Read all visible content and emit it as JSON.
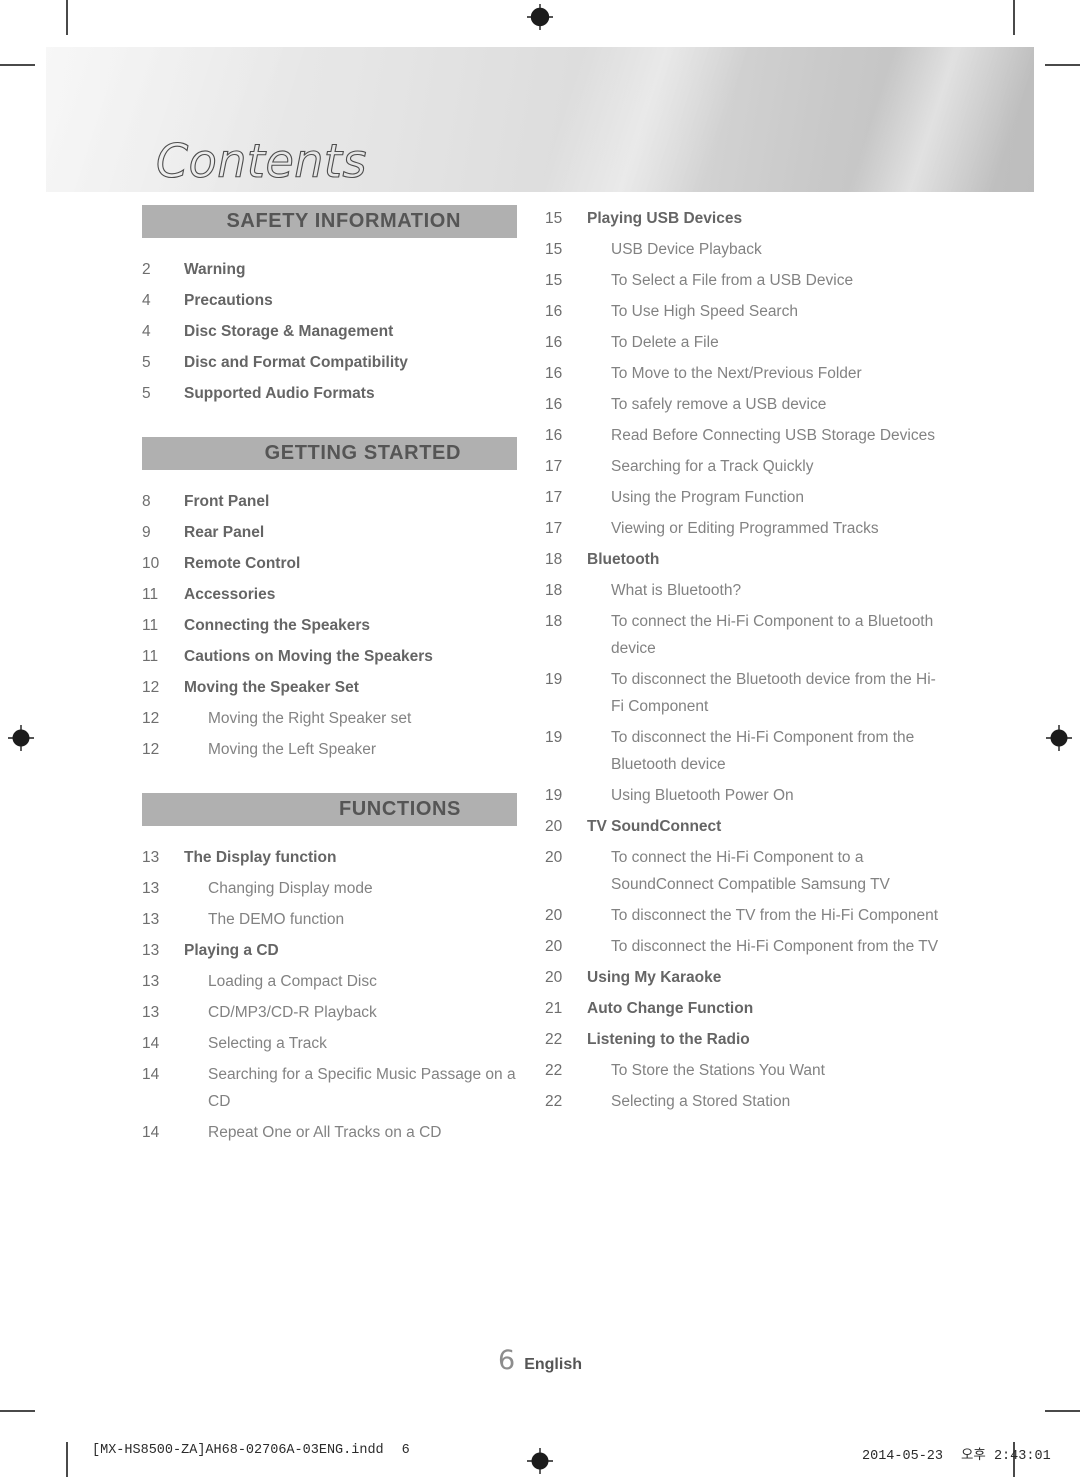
{
  "banner": {
    "title": "Contents"
  },
  "columns": {
    "left": [
      {
        "type": "section",
        "label": "SAFETY INFORMATION",
        "entries": [
          {
            "page": "2",
            "title": "Warning",
            "level": 1
          },
          {
            "page": "4",
            "title": "Precautions",
            "level": 1
          },
          {
            "page": "4",
            "title": "Disc Storage & Management",
            "level": 1
          },
          {
            "page": "5",
            "title": "Disc and Format Compatibility",
            "level": 1
          },
          {
            "page": "5",
            "title": "Supported Audio Formats",
            "level": 1
          }
        ]
      },
      {
        "type": "section",
        "label": "GETTING STARTED",
        "entries": [
          {
            "page": "8",
            "title": "Front Panel",
            "level": 1
          },
          {
            "page": "9",
            "title": "Rear Panel",
            "level": 1
          },
          {
            "page": "10",
            "title": "Remote Control",
            "level": 1
          },
          {
            "page": "11",
            "title": "Accessories",
            "level": 1
          },
          {
            "page": "11",
            "title": "Connecting the Speakers",
            "level": 1
          },
          {
            "page": "11",
            "title": "Cautions on Moving the Speakers",
            "level": 1
          },
          {
            "page": "12",
            "title": "Moving the Speaker Set",
            "level": 1
          },
          {
            "page": "12",
            "title": "Moving the Right Speaker set",
            "level": 2
          },
          {
            "page": "12",
            "title": "Moving the Left Speaker",
            "level": 2
          }
        ]
      },
      {
        "type": "section",
        "label": "FUNCTIONS",
        "entries": [
          {
            "page": "13",
            "title": "The Display function",
            "level": 1
          },
          {
            "page": "13",
            "title": "Changing Display mode",
            "level": 2
          },
          {
            "page": "13",
            "title": "The DEMO function",
            "level": 2
          },
          {
            "page": "13",
            "title": "Playing a CD",
            "level": 1
          },
          {
            "page": "13",
            "title": "Loading a Compact Disc",
            "level": 2
          },
          {
            "page": "13",
            "title": "CD/MP3/CD-R Playback",
            "level": 2
          },
          {
            "page": "14",
            "title": "Selecting a Track",
            "level": 2
          },
          {
            "page": "14",
            "title": "Searching for a Specific Music Passage on a CD",
            "level": 2
          },
          {
            "page": "14",
            "title": "Repeat One or All Tracks on a CD",
            "level": 2
          }
        ]
      }
    ],
    "right": [
      {
        "type": "plain",
        "entries": [
          {
            "page": "15",
            "title": "Playing USB Devices",
            "level": 1
          },
          {
            "page": "15",
            "title": "USB Device Playback",
            "level": 2
          },
          {
            "page": "15",
            "title": "To Select a File from a USB Device",
            "level": 2
          },
          {
            "page": "16",
            "title": "To Use High Speed Search",
            "level": 2
          },
          {
            "page": "16",
            "title": "To Delete a File",
            "level": 2
          },
          {
            "page": "16",
            "title": "To Move to the Next/Previous Folder",
            "level": 2
          },
          {
            "page": "16",
            "title": "To safely remove a USB device",
            "level": 2
          },
          {
            "page": "16",
            "title": "Read Before Connecting USB Storage Devices",
            "level": 2
          },
          {
            "page": "17",
            "title": "Searching for a Track Quickly",
            "level": 2
          },
          {
            "page": "17",
            "title": "Using the Program Function",
            "level": 2
          },
          {
            "page": "17",
            "title": "Viewing or Editing Programmed Tracks",
            "level": 2
          },
          {
            "page": "18",
            "title": "Bluetooth",
            "level": 1
          },
          {
            "page": "18",
            "title": "What is Bluetooth?",
            "level": 2
          },
          {
            "page": "18",
            "title": "To connect the Hi-Fi Component to a Bluetooth device",
            "level": 2
          },
          {
            "page": "19",
            "title": "To disconnect the Bluetooth device from the Hi-Fi Component",
            "level": 2
          },
          {
            "page": "19",
            "title": "To disconnect the Hi-Fi Component from the Bluetooth device",
            "level": 2
          },
          {
            "page": "19",
            "title": "Using Bluetooth Power On",
            "level": 2
          },
          {
            "page": "20",
            "title": "TV SoundConnect",
            "level": 1
          },
          {
            "page": "20",
            "title": "To connect the Hi-Fi Component to a SoundConnect Compatible Samsung TV",
            "level": 2
          },
          {
            "page": "20",
            "title": "To disconnect the TV from the Hi-Fi Component",
            "level": 2
          },
          {
            "page": "20",
            "title": "To disconnect the Hi-Fi Component from the TV",
            "level": 2
          },
          {
            "page": "20",
            "title": "Using My Karaoke",
            "level": 1
          },
          {
            "page": "21",
            "title": "Auto Change Function",
            "level": 1
          },
          {
            "page": "22",
            "title": "Listening to the Radio",
            "level": 1
          },
          {
            "page": "22",
            "title": "To Store the Stations You Want",
            "level": 2
          },
          {
            "page": "22",
            "title": "Selecting a Stored Station",
            "level": 2
          }
        ]
      }
    ]
  },
  "footer": {
    "page_number": "6",
    "language": "English"
  },
  "production": {
    "file_name": "[MX-HS8500-ZA]AH68-02706A-03ENG.indd",
    "file_page": "6",
    "date": "2014-05-23",
    "time": "오후 2:43:01"
  },
  "colors": {
    "section_bar": "#b0b0b0",
    "level1_text": "#656565",
    "level2_text": "#828282",
    "page_number_text": "#6e6e6e"
  }
}
